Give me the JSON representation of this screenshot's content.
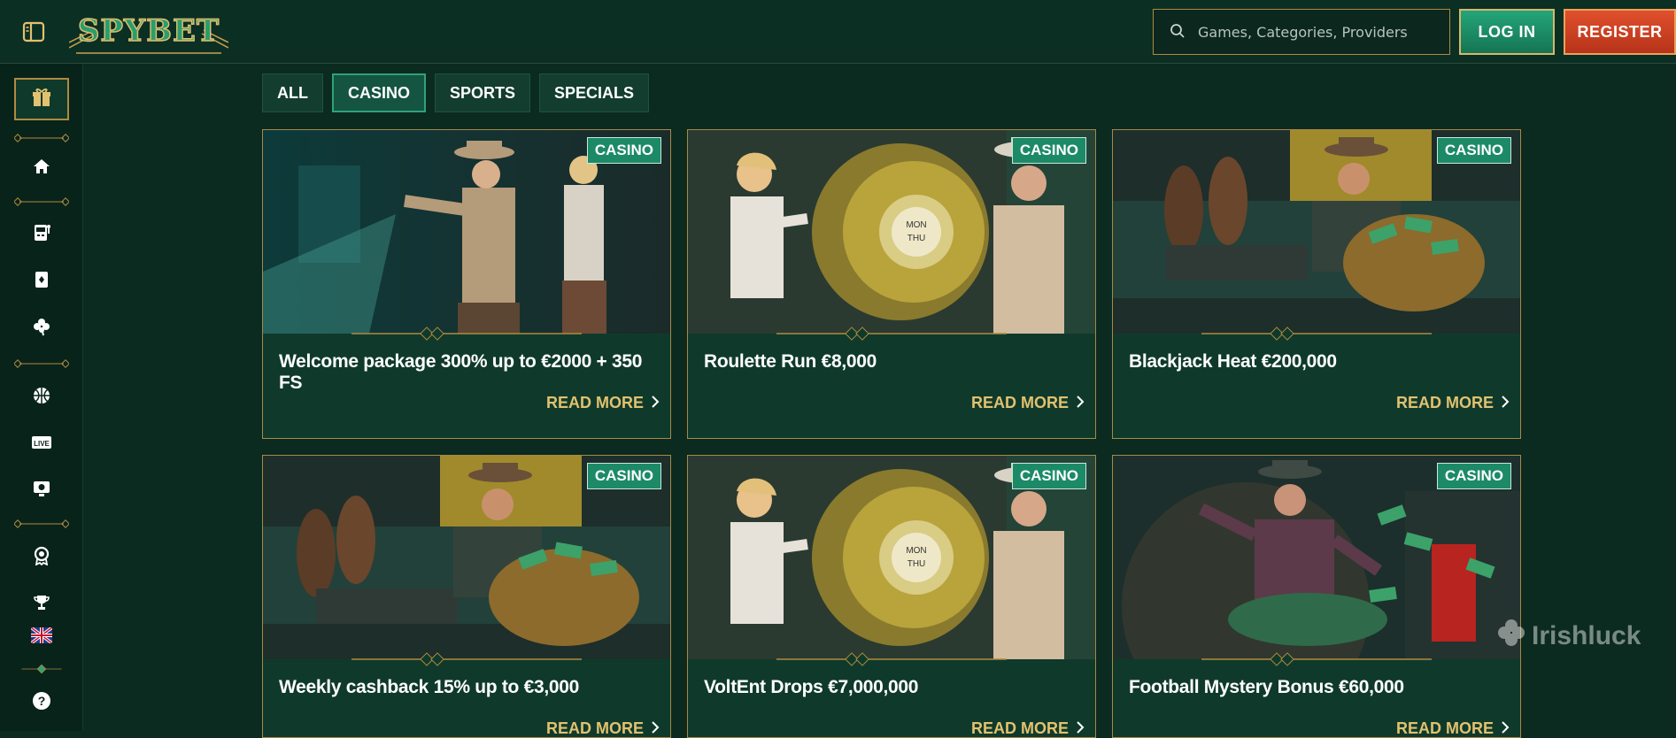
{
  "header": {
    "logo_text": "SPYBET",
    "search_placeholder": "Games, Categories, Providers",
    "login_label": "LOG IN",
    "register_label": "REGISTER"
  },
  "sidebar": {
    "items": [
      {
        "icon": "gift-icon"
      },
      {
        "icon": "home-icon"
      },
      {
        "icon": "slot-machine-icon"
      },
      {
        "icon": "card-icon"
      },
      {
        "icon": "clover-icon"
      },
      {
        "icon": "basketball-icon"
      },
      {
        "icon": "live-icon",
        "label": "LIVE"
      },
      {
        "icon": "virtual-sports-icon"
      },
      {
        "icon": "badge-icon"
      },
      {
        "icon": "trophy-icon"
      },
      {
        "icon": "uk-flag-icon"
      },
      {
        "icon": "help-icon",
        "label": "?"
      }
    ]
  },
  "tabs": [
    {
      "label": "ALL",
      "active": false
    },
    {
      "label": "CASINO",
      "active": true
    },
    {
      "label": "SPORTS",
      "active": false
    },
    {
      "label": "SPECIALS",
      "active": false
    }
  ],
  "cards": [
    {
      "badge": "CASINO",
      "title": "Welcome package 300% up to €2000 + 350 FS",
      "cta": "READ MORE"
    },
    {
      "badge": "CASINO",
      "title": "Roulette Run €8,000",
      "cta": "READ MORE"
    },
    {
      "badge": "CASINO",
      "title": "Blackjack Heat €200,000",
      "cta": "READ MORE"
    },
    {
      "badge": "CASINO",
      "title": "Weekly cashback 15% up to €3,000",
      "cta": "READ MORE"
    },
    {
      "badge": "CASINO",
      "title": "VoltEnt Drops €7,000,000",
      "cta": "READ MORE"
    },
    {
      "badge": "CASINO",
      "title": "Football Mystery Bonus €60,000",
      "cta": "READ MORE"
    }
  ],
  "watermark": "Irishluck",
  "colors": {
    "background": "#0b2a20",
    "gold": "#e2c16f",
    "login": "#1f9470",
    "register": "#d4452a",
    "badge": "#1c8a66"
  }
}
